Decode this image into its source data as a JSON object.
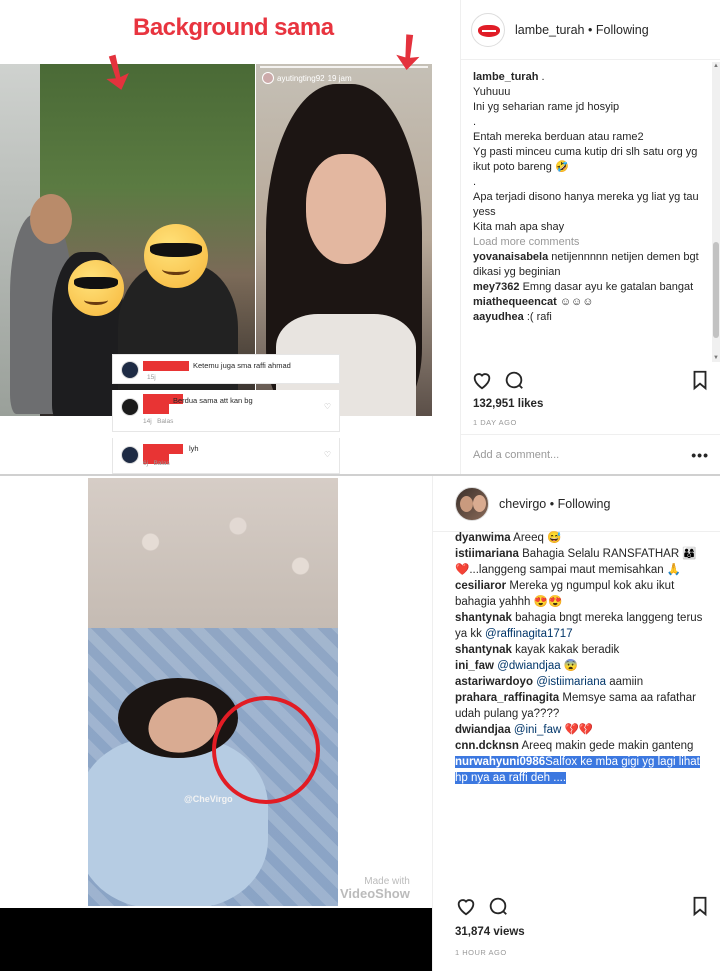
{
  "panel1": {
    "annotation_title": "Background sama",
    "story": {
      "user": "ayutingting92",
      "time": "19 jam"
    },
    "overlay_comments": [
      {
        "text": "Ketemu juga sma raffi ahmad",
        "meta": "15j"
      },
      {
        "text": "Berdua sama att kan bg",
        "meta": "14j   Balas"
      },
      {
        "text": "lyh",
        "meta": "6j   Balas"
      }
    ],
    "post": {
      "username": "lambe_turah",
      "dot": "•",
      "following": "Following",
      "caption_user": "lambe_turah",
      "caption_user_suffix": ".",
      "caption_lines": [
        "Yuhuuu",
        "Ini yg seharian rame jd hosyip",
        ".",
        "Entah mereka berduan atau rame2",
        "Yg pasti minceu cuma kutip dri slh satu org yg ikut poto bareng 🤣",
        ".",
        "Apa terjadi disono hanya mereka yg liat yg tau yess",
        "Kita mah apa shay"
      ],
      "load_more": "Load more comments",
      "comments": [
        {
          "user": "yovanaisabela",
          "text": "netijennnnn netijen demen bgt dikasi yg beginian"
        },
        {
          "user": "mey7362",
          "text": "Emng dasar ayu ke gatalan bangat"
        },
        {
          "user": "miathequeencat",
          "text": "☺☺☺"
        },
        {
          "user": "aayudhea",
          "text": ":( rafi"
        }
      ],
      "likes": "132,951 likes",
      "time_ago": "1 DAY AGO",
      "add_comment_placeholder": "Add a comment...",
      "more": "•••"
    }
  },
  "panel2": {
    "watermark": "@CheVirgo",
    "made_with": "Made with",
    "app": "VideoShow",
    "post": {
      "username": "chevirgo",
      "dot": "•",
      "following": "Following",
      "comments": [
        {
          "user": "dyanwima",
          "text": "Areeq 😅"
        },
        {
          "user": "istiimariana",
          "text": "Bahagia Selalu RANSFATHAR 👨‍👩‍👦❤️...langgeng sampai maut memisahkan 🙏"
        },
        {
          "user": "cesiliaror",
          "text": "Mereka yg ngumpul kok aku ikut bahagia yahhh 😍😍"
        },
        {
          "user": "shantynak",
          "text": "bahagia bngt mereka langgeng terus ya kk ",
          "mention": "@raffinagita1717"
        },
        {
          "user": "shantynak",
          "text": "kayak kakak beradik"
        },
        {
          "user": "ini_faw",
          "text": " 😨",
          "mention": "@dwiandjaa"
        },
        {
          "user": "astariwardoyo",
          "text": " aamiin",
          "mention": "@istiimariana"
        },
        {
          "user": "prahara_raffinagita",
          "text": "Memsye sama aa rafathar udah pulang ya????"
        },
        {
          "user": "dwiandjaa",
          "text": " 💔💔",
          "mention": "@ini_faw"
        },
        {
          "user": "cnn.dcknsn",
          "text": "Areeq makin gede makin ganteng"
        }
      ],
      "highlighted_comment": {
        "user": "nurwahyuni0986",
        "text": "Salfox ke mba gigi yg lagi lihat hp nya aa raffi deh ...."
      },
      "likes": "31,874 views",
      "time_ago": "1 HOUR AGO"
    }
  },
  "colors": {
    "annotation_red": "#e8343f",
    "highlight": "#3c78e0",
    "mention": "#003569"
  }
}
